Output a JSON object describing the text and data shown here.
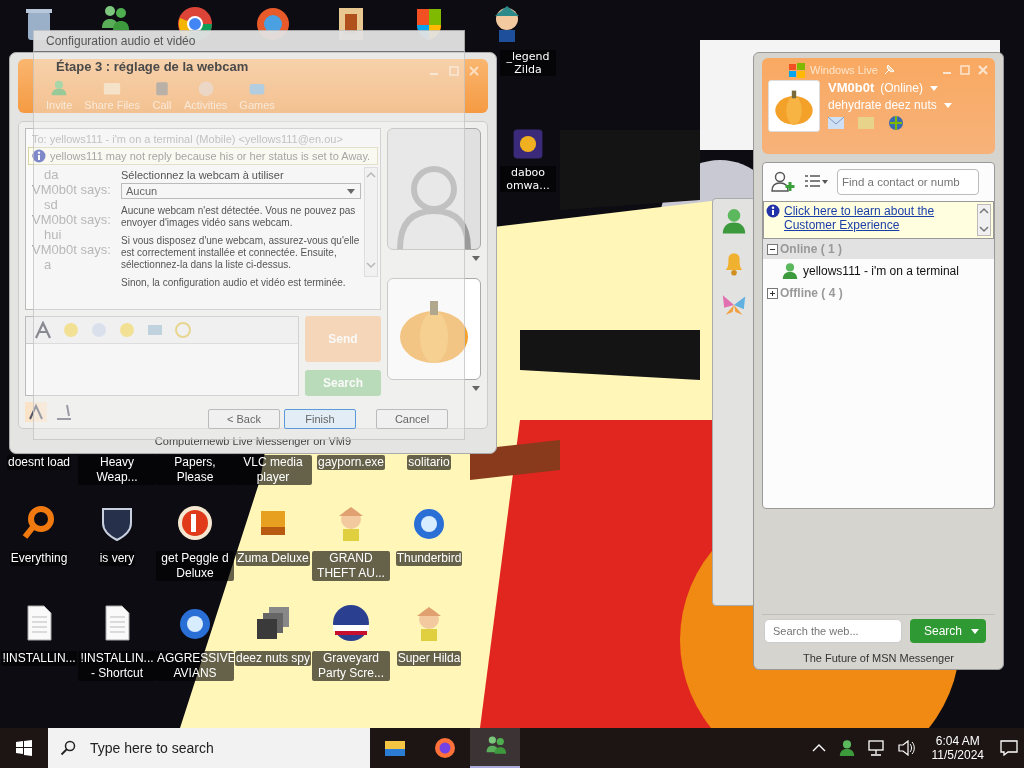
{
  "desktop_icon_rows": [
    {
      "icons_visible": false,
      "items": [
        {
          "label": "doesnt load"
        },
        {
          "label": "Heavy Weap..."
        },
        {
          "label": "Papers, Please"
        },
        {
          "label": "VLC media player"
        },
        {
          "label": "gayporn.exe"
        },
        {
          "label": "solitario"
        }
      ]
    },
    {
      "icons_visible": true,
      "items": [
        {
          "kind": "ring",
          "label": "Everything"
        },
        {
          "kind": "shield",
          "label": "is very"
        },
        {
          "kind": "ball",
          "label": "get Peggle d Deluxe"
        },
        {
          "kind": "block",
          "label": "Zuma Deluxe"
        },
        {
          "kind": "character",
          "label": "GRAND THEFT AU..."
        },
        {
          "kind": "bird",
          "label": "Thunderbird"
        }
      ]
    },
    {
      "icons_visible": true,
      "items": [
        {
          "kind": "document",
          "label": "!INSTALLIN..."
        },
        {
          "kind": "document",
          "label": "!INSTALLIN... - Shortcut"
        },
        {
          "kind": "bird",
          "label": "AGGRESSIVE AVIANS"
        },
        {
          "kind": "stack",
          "label": "deez nuts spy"
        },
        {
          "kind": "badge",
          "label": "Graveyard Party Scre..."
        },
        {
          "kind": "character",
          "label": "Super Hilda"
        }
      ]
    }
  ],
  "desktop_icons_side": [
    {
      "label": "_legend Zilda"
    },
    {
      "label": "daboo omwa..."
    }
  ],
  "chat_window": {
    "toolbar": [
      {
        "label": "Invite"
      },
      {
        "label": "Share Files"
      },
      {
        "label": "Call"
      },
      {
        "label": "Activities"
      },
      {
        "label": "Games"
      }
    ],
    "to_line": "To: yellows111 - i'm on a terminal (Mobile) <yellows111@en.ou>",
    "notice": "yellows111 may not reply because his or her status is set to Away.",
    "messages": [
      {
        "kind": "text",
        "text": "da"
      },
      {
        "kind": "sender",
        "text": "VM0b0t says:"
      },
      {
        "kind": "text",
        "text": "sd"
      },
      {
        "kind": "sender",
        "text": "VM0b0t says:"
      },
      {
        "kind": "text",
        "text": "hui"
      },
      {
        "kind": "sender",
        "text": "VM0b0t says:"
      },
      {
        "kind": "text",
        "text": "a"
      }
    ],
    "send_button": "Send",
    "search_button": "Search",
    "footer": "Computernewb Live Messenger on VM9"
  },
  "wizard": {
    "title": "Configuration audio et vidéo",
    "step": "Étape 3 : réglage de la webcam",
    "select_label": "Sélectionnez la webcam à utiliser",
    "select_value": "Aucun",
    "paragraphs": [
      "Aucune webcam n'est détectée. Vous ne pouvez pas envoyer d'images vidéo sans webcam.",
      "Si vous disposez d'une webcam, assurez-vous qu'elle est correctement installée et connectée. Ensuite, sélectionnez-la dans la liste ci-dessus.",
      "Sinon, la configuration audio et vidéo est terminée."
    ],
    "buttons": [
      {
        "label": "< Back",
        "focused": false
      },
      {
        "label": "Finish",
        "focused": true
      },
      {
        "label": "Cancel",
        "focused": false
      }
    ]
  },
  "messenger": {
    "title": "Windows Live",
    "user": "VM0b0t",
    "status": "(Online)",
    "personal_message": "dehydrate deez nuts",
    "contact_search": {
      "placeholder": "Find a contact or numb"
    },
    "notice_link": "Click here to learn about the Customer Experience",
    "groups": [
      {
        "name": "Online ( 1 )",
        "expanded": true,
        "contacts": [
          {
            "name": "yellows111 - i'm on a terminal"
          }
        ]
      },
      {
        "name": "Offline ( 4 )",
        "expanded": false
      }
    ],
    "web_search": {
      "placeholder": "Search the web...",
      "button": "Search"
    },
    "footer": "The Future of MSN Messenger"
  },
  "taskbar": {
    "search_placeholder": "Type here to search",
    "apps": [
      {
        "kind": "explorer",
        "active": false
      },
      {
        "kind": "firefox",
        "active": false
      },
      {
        "kind": "messenger",
        "active": true
      }
    ],
    "time": "6:04 AM",
    "date": "11/5/2024"
  }
}
